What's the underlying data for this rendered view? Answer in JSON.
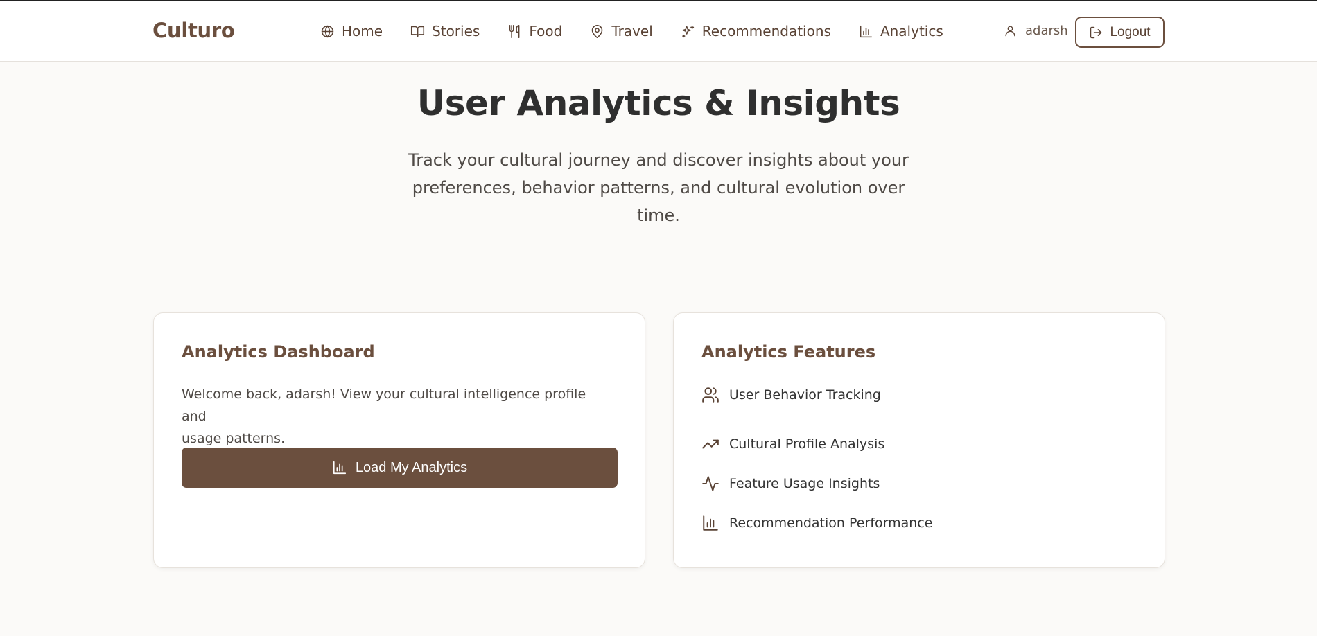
{
  "header": {
    "brand": "Culturo",
    "nav": [
      {
        "label": "Home",
        "icon": "globe-icon"
      },
      {
        "label": "Stories",
        "icon": "book-icon"
      },
      {
        "label": "Food",
        "icon": "utensils-icon"
      },
      {
        "label": "Travel",
        "icon": "map-pin-icon"
      },
      {
        "label": "Recommendations",
        "icon": "sparkles-icon"
      },
      {
        "label": "Analytics",
        "icon": "bar-chart-icon"
      }
    ],
    "username": "adarsh",
    "logout_label": "Logout"
  },
  "hero": {
    "title": "User Analytics & Insights",
    "subtitle_line1": "Track your cultural journey and discover insights about your",
    "subtitle_line2": "preferences, behavior patterns, and cultural evolution over time."
  },
  "dashboard": {
    "title": "Analytics Dashboard",
    "desc_line1": "Welcome back, adarsh! View your cultural intelligence profile and",
    "desc_line2": "usage patterns.",
    "button_label": "Load My Analytics"
  },
  "features": {
    "title": "Analytics Features",
    "items": [
      {
        "label": "User Behavior Tracking",
        "icon": "users-icon"
      },
      {
        "label": "Cultural Profile Analysis",
        "icon": "trending-up-icon"
      },
      {
        "label": "Feature Usage Insights",
        "icon": "activity-icon"
      },
      {
        "label": "Recommendation Performance",
        "icon": "bar-chart-icon"
      }
    ]
  },
  "colors": {
    "brand": "#6b4f3e",
    "background": "#fbfaf8",
    "card": "#ffffff"
  }
}
